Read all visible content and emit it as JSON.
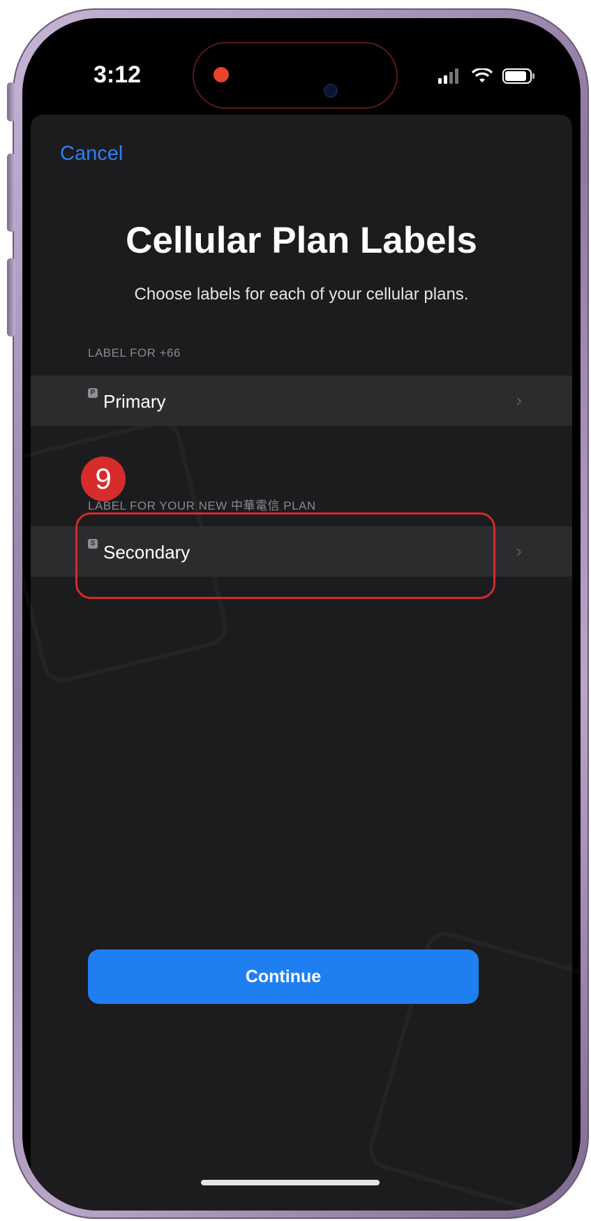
{
  "status_bar": {
    "time": "3:12",
    "icons": [
      "cellular-signal-icon",
      "wifi-icon",
      "battery-icon"
    ]
  },
  "sheet": {
    "cancel_label": "Cancel",
    "title": "Cellular Plan Labels",
    "subtitle": "Choose labels for each of your cellular plans.",
    "sections": [
      {
        "header": "LABEL FOR +66",
        "row_label": "Primary",
        "badge": "P"
      },
      {
        "header": "LABEL FOR YOUR NEW 中華電信 PLAN",
        "row_label": "Secondary",
        "badge": "S"
      }
    ],
    "continue_label": "Continue"
  },
  "annotation": {
    "step_number": "9",
    "highlight_color": "#d42a2a"
  },
  "colors": {
    "accent": "#1f7ff0",
    "link": "#2f7ff2",
    "sheet_bg": "#1c1c1e",
    "row_bg": "#2c2c2e"
  }
}
